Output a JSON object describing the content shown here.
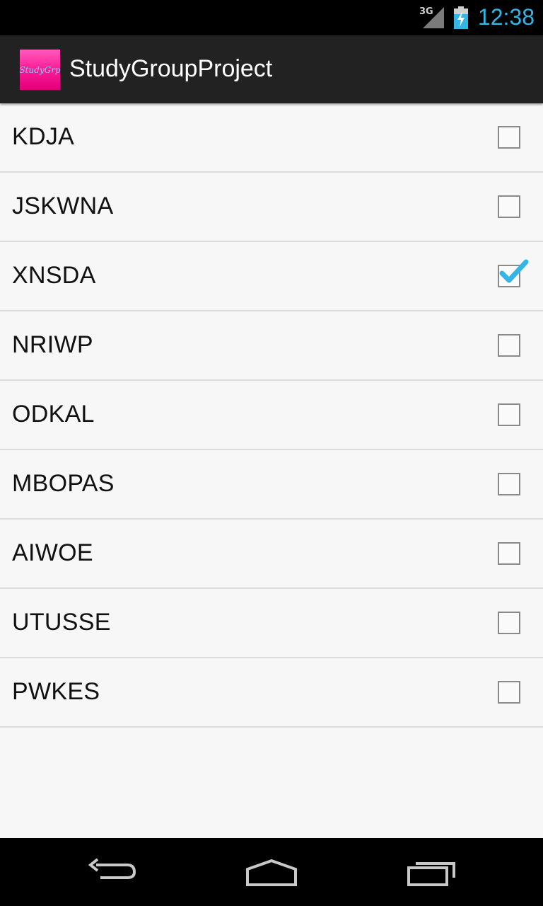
{
  "status_bar": {
    "network": "3G",
    "time": "12:38",
    "icons": [
      "signal-icon",
      "battery-charging-icon"
    ]
  },
  "action_bar": {
    "app_icon_text": "StudyGrp",
    "title": "StudyGroupProject"
  },
  "list": {
    "items": [
      {
        "label": "KDJA",
        "checked": false
      },
      {
        "label": "JSKWNA",
        "checked": false
      },
      {
        "label": "XNSDA",
        "checked": true
      },
      {
        "label": "NRIWP",
        "checked": false
      },
      {
        "label": "ODKAL",
        "checked": false
      },
      {
        "label": "MBOPAS",
        "checked": false
      },
      {
        "label": "AIWOE",
        "checked": false
      },
      {
        "label": "UTUSSE",
        "checked": false
      },
      {
        "label": "PWKES",
        "checked": false
      }
    ]
  },
  "nav_bar": {
    "buttons": [
      "back-icon",
      "home-icon",
      "recent-apps-icon"
    ]
  },
  "colors": {
    "accent": "#33b5e5",
    "app_icon": "#ff1a95",
    "action_bar": "#222222",
    "background": "#f7f7f7"
  }
}
